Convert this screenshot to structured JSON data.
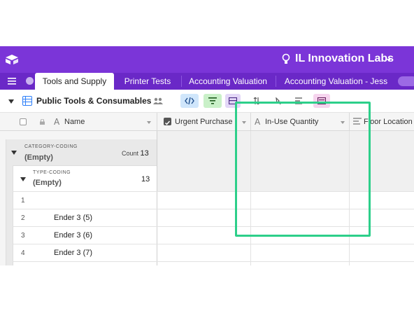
{
  "header": {
    "base_name": "IL Innovation Labs",
    "brand_color": "#7b35d8",
    "icons": [
      "logo-icon",
      "lightbulb-icon",
      "chevron-down-icon"
    ]
  },
  "tabs": [
    {
      "label": "Tools and Supply",
      "active": true
    },
    {
      "label": "Printer Tests",
      "active": false
    },
    {
      "label": "Accounting Valuation",
      "active": false
    },
    {
      "label": "Accounting Valuation - Jess",
      "active": false
    }
  ],
  "toolbar": {
    "view_name": "Public Tools & Consumables"
  },
  "columns": [
    {
      "label": "Name"
    },
    {
      "label": "Urgent Purchase"
    },
    {
      "label": "In-Use Quantity"
    },
    {
      "label": "Floor Location"
    }
  ],
  "group1": {
    "label": "CATEGORY-CODING",
    "value": "(Empty)",
    "count_label": "Count",
    "count": "13"
  },
  "group2": {
    "label": "TYPE-CODING",
    "value": "(Empty)",
    "count": "13"
  },
  "rows": [
    {
      "num": "1",
      "name": ""
    },
    {
      "num": "2",
      "name": "Ender 3 (5)"
    },
    {
      "num": "3",
      "name": "Ender 3 (6)"
    },
    {
      "num": "4",
      "name": "Ender 3 (7)"
    }
  ],
  "annotation": {
    "color": "#2dcf8a"
  }
}
